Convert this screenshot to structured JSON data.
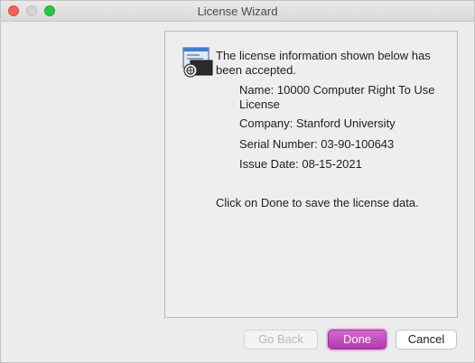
{
  "window": {
    "title": "License Wizard"
  },
  "panel": {
    "accept_message": "The license information shown below has been accepted.",
    "name_line": "Name: 10000 Computer Right To Use License",
    "company_line": "Company: Stanford University",
    "serial_line": "Serial Number: 03-90-100643",
    "issue_date_line": "Issue Date: 08-15-2021",
    "done_hint": "Click on Done to save the license data.",
    "icon": "license-certificate-icon"
  },
  "buttons": {
    "back": "Go Back",
    "done": "Done",
    "cancel": "Cancel"
  },
  "colors": {
    "accent": "#c04ebb",
    "close": "#fc5f57",
    "maximize": "#28c840"
  }
}
